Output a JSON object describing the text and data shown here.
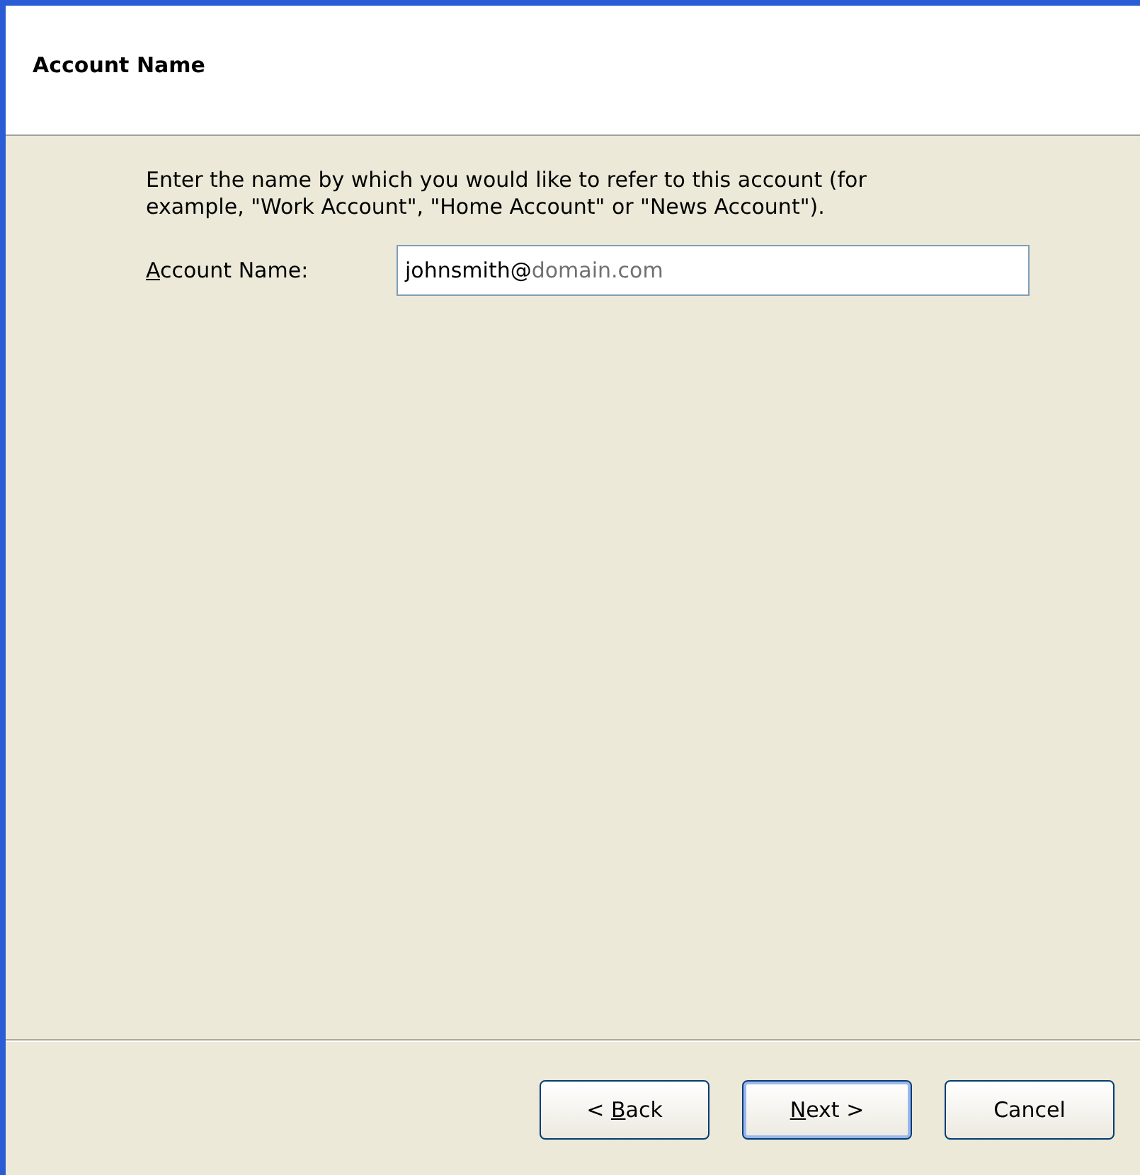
{
  "header": {
    "title": "Account Name"
  },
  "description": "Enter the name by which you would like to refer to this account (for example, \"Work Account\", \"Home Account\" or \"News Account\").",
  "field": {
    "label": {
      "key": "A",
      "after": "ccount Name:"
    },
    "value": "johnsmith@",
    "suggestion": "domain.com"
  },
  "buttons": [
    {
      "label": {
        "before": "< ",
        "key": "B",
        "after": "ack"
      },
      "default": false
    },
    {
      "label": {
        "key": "N",
        "after": "ext >"
      },
      "default": true
    },
    {
      "label": {
        "before": "Cancel"
      },
      "default": false
    }
  ]
}
